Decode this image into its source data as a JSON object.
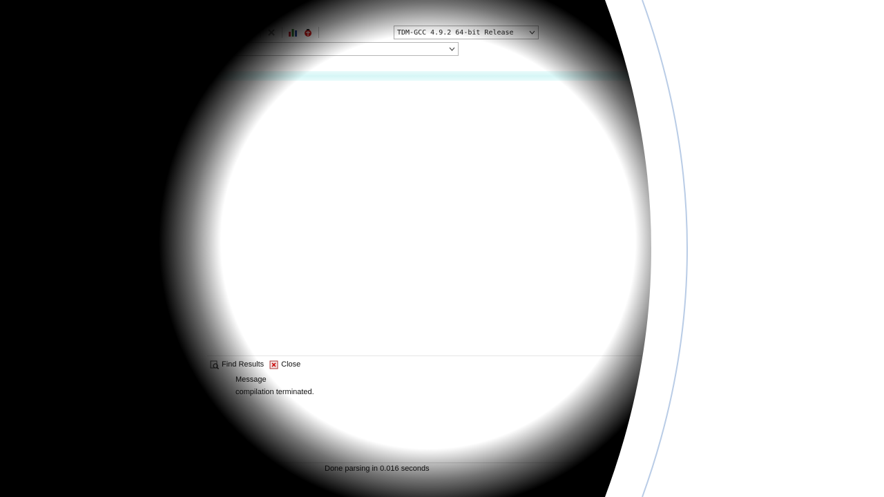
{
  "toolbar": {
    "icons": [
      "grid-icon",
      "grid-icon",
      "checkmark-icon",
      "stop-icon",
      "chart-icon",
      "debug-icon"
    ],
    "compiler_select": {
      "value": "TDM-GCC 4.9.2 64-bit Release"
    }
  },
  "bottom_panel": {
    "tabs": [
      {
        "label": "Find Results",
        "icon": "find-icon"
      },
      {
        "label": "Close",
        "icon": "close-icon"
      }
    ],
    "message_header": "Message",
    "messages": [
      "compilation terminated."
    ]
  },
  "status_bar": {
    "text": "Done parsing in 0.016 seconds"
  },
  "colors": {
    "highlight_line": "#d6f6f6",
    "accent_curve": "#9ab4d8"
  }
}
